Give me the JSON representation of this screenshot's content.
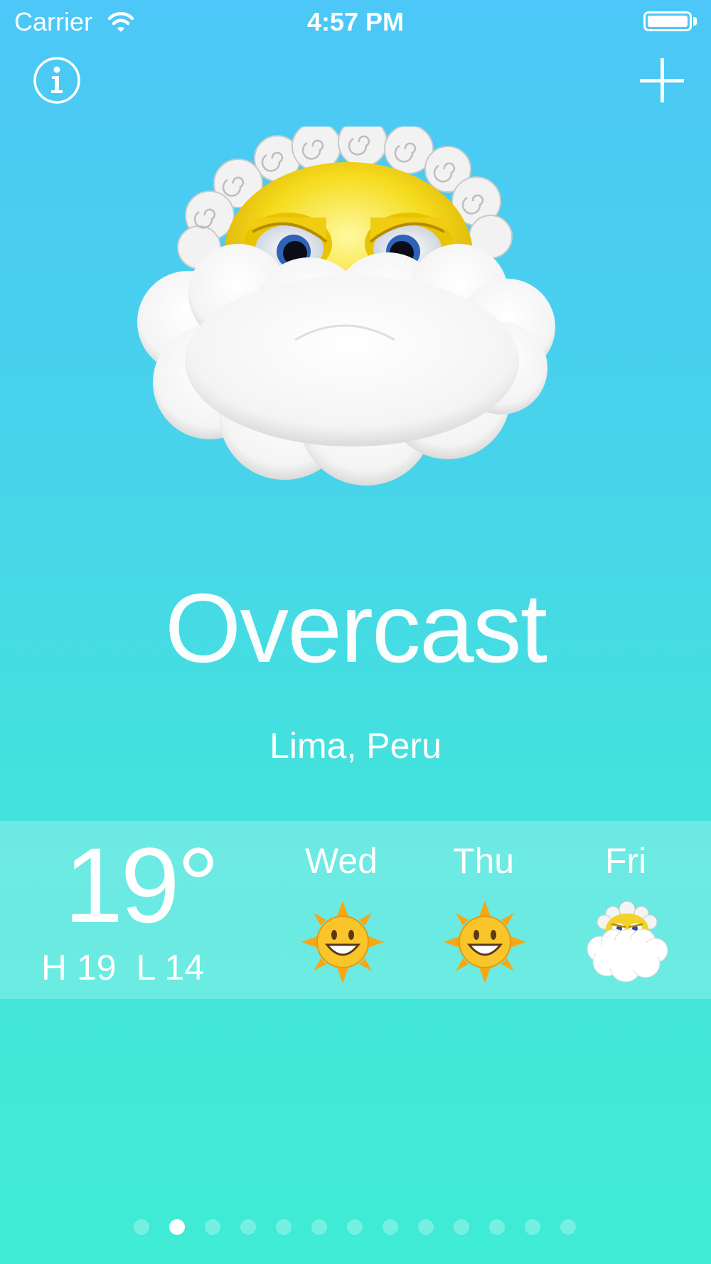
{
  "status_bar": {
    "carrier": "Carrier",
    "time": "4:57 PM"
  },
  "nav": {
    "info_icon": "info-icon",
    "add_icon": "plus-icon"
  },
  "current": {
    "icon": "overcast-cloud-face-icon",
    "condition": "Overcast",
    "location": "Lima, Peru",
    "temperature": "19°",
    "high_label": "H 19",
    "low_label": "L 14"
  },
  "forecast": [
    {
      "day": "Wed",
      "icon": "sunny-smiley-icon"
    },
    {
      "day": "Thu",
      "icon": "sunny-smiley-icon"
    },
    {
      "day": "Fri",
      "icon": "overcast-cloud-face-icon"
    }
  ],
  "pages": {
    "count": 13,
    "current_index": 1
  },
  "colors": {
    "top_gradient": "#4cc7f7",
    "bottom_gradient": "#40ecd5",
    "band": "rgba(255,255,255,0.22)",
    "text": "#ffffff"
  }
}
